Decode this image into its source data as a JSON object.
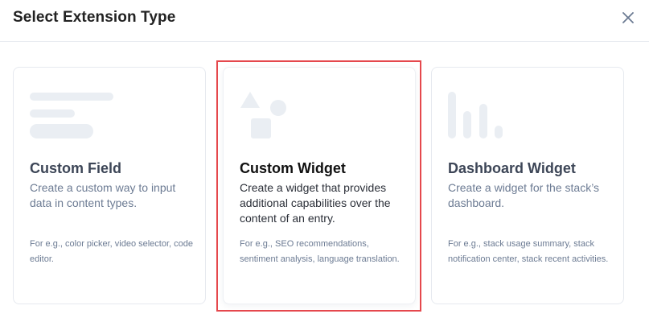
{
  "dialog": {
    "title": "Select Extension Type",
    "close_icon": "close-icon"
  },
  "cards": [
    {
      "title": "Custom Field",
      "description": "Create a custom way to input data in content types.",
      "example": "For e.g., color picker, video selector, code editor.",
      "icon": "custom-field-icon",
      "selected": false
    },
    {
      "title": "Custom Widget",
      "description": "Create a widget that provides additional capabilities over the content of an entry.",
      "example": "For e.g., SEO recommendations, sentiment analysis, language translation.",
      "icon": "custom-widget-icon",
      "selected": true
    },
    {
      "title": "Dashboard Widget",
      "description": "Create a widget for the stack’s dashboard.",
      "example": "For e.g., stack usage summary, stack notification center, stack recent activities.",
      "icon": "dashboard-widget-icon",
      "selected": false
    }
  ],
  "colors": {
    "selection_border": "#e5484d",
    "illustration": "#eaeef3",
    "muted_text": "#6c7b93"
  }
}
